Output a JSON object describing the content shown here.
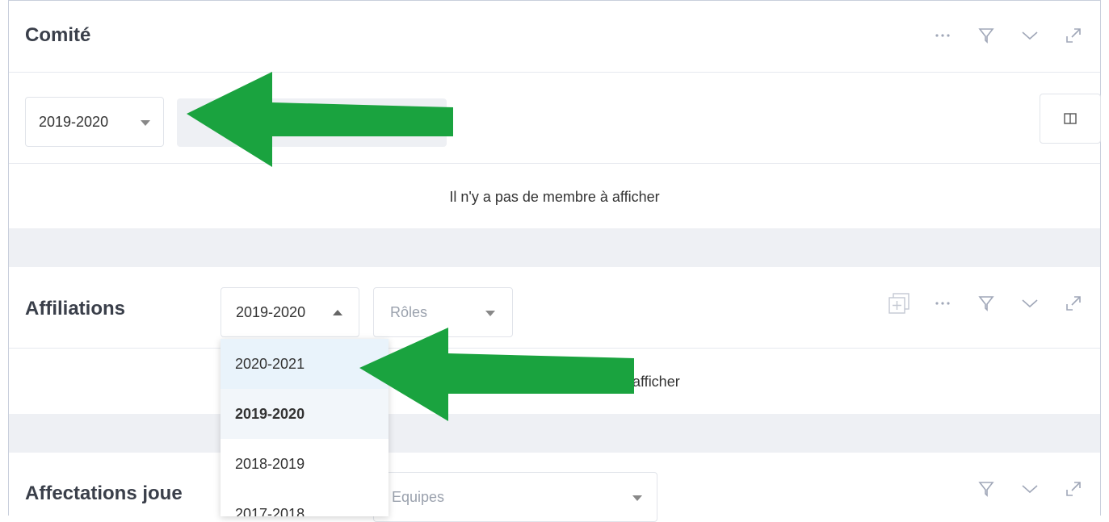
{
  "comite": {
    "title": "Comité",
    "season_select": "2019-2020",
    "empty_message": "Il n'y a pas de membre à afficher"
  },
  "affiliations": {
    "title": "Affiliations",
    "season_select": "2019-2020",
    "roles_placeholder": "Rôles",
    "empty_message_visible_fragment": "afficher",
    "dropdown_options": [
      "2020-2021",
      "2019-2020",
      "2018-2019",
      "2017-2018"
    ]
  },
  "affectations": {
    "title": "Affectations joue",
    "equipes_placeholder": "Equipes"
  },
  "icons": {
    "more": "ellipsis-icon",
    "filter": "filter-icon",
    "collapse": "chevron-down-icon",
    "expand": "expand-icon",
    "columns": "columns-icon",
    "add_copy": "add-copy-icon"
  },
  "annotation_arrow_color": "#1aa33f"
}
